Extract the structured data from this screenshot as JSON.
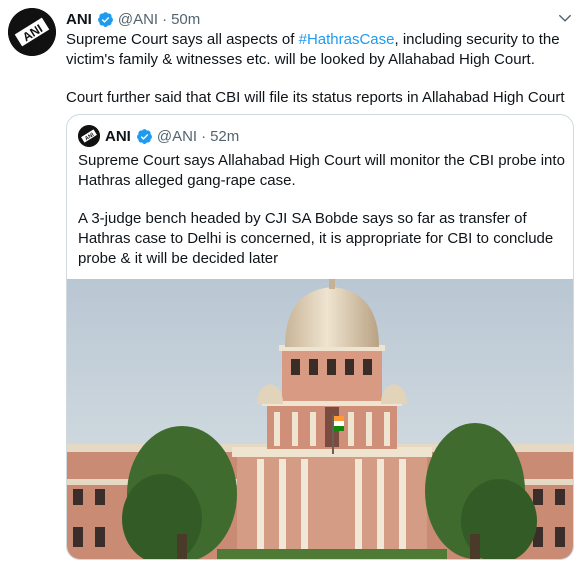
{
  "tweet": {
    "author_name": "ANI",
    "handle": "@ANI",
    "separator": "·",
    "time": "50m",
    "text_before_hashtag": "Supreme Court says all aspects of ",
    "hashtag": "#HathrasCase",
    "text_after_hashtag": ", including security to the victim's family & witnesses etc. will be looked by Allahabad High Court.",
    "text_paragraph_2": "Court further said that CBI will file its status reports in Allahabad High Court"
  },
  "quoted_tweet": {
    "author_name": "ANI",
    "handle": "@ANI",
    "separator": "·",
    "time": "52m",
    "paragraph_1": "Supreme Court says Allahabad High Court will monitor the CBI probe into Hathras alleged gang-rape case.",
    "paragraph_2": "A 3-judge bench headed by CJI SA Bobde says so far as transfer of Hathras case to Delhi is concerned, it is appropriate for CBI to conclude probe & it will be decided later"
  },
  "icons": {
    "more": "chevron-down-icon",
    "verified": "verified-badge-icon"
  },
  "colors": {
    "link": "#1d9bf0",
    "muted": "#536471",
    "border": "#cfd9de"
  }
}
